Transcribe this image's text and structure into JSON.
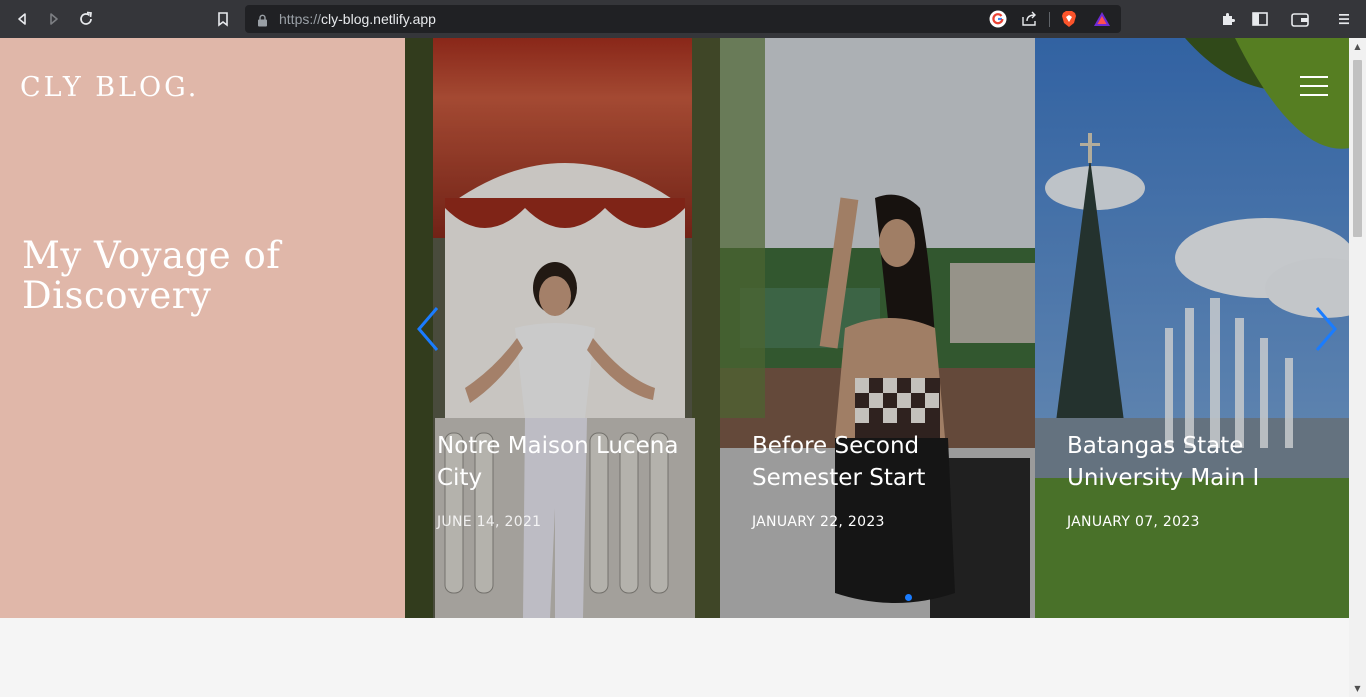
{
  "browser": {
    "url_scheme": "https://",
    "url_host": "cly-blog.netlify.app",
    "icons": [
      "back-icon",
      "forward-icon",
      "reload-icon",
      "bookmark-icon",
      "lock-icon",
      "google-icon",
      "share-icon",
      "brave-shield-icon",
      "brave-rewards-icon",
      "extensions-icon",
      "sidebar-icon",
      "wallet-icon",
      "menu-icon"
    ]
  },
  "site": {
    "brand": "CLY BLOG.",
    "hero_title": "My Voyage of Discovery"
  },
  "slides": [
    {
      "title": "Notre Maison Lucena City",
      "date": "JUNE 14, 2021"
    },
    {
      "title": "Before Second Semester Start",
      "date": "JANUARY 22, 2023"
    },
    {
      "title": "Batangas State University Main I",
      "date": "JANUARY 07, 2023"
    }
  ],
  "colors": {
    "hero_bg": "#e0b7a9",
    "accent_blue": "#1a7cff",
    "chrome_bg": "#35363a"
  }
}
